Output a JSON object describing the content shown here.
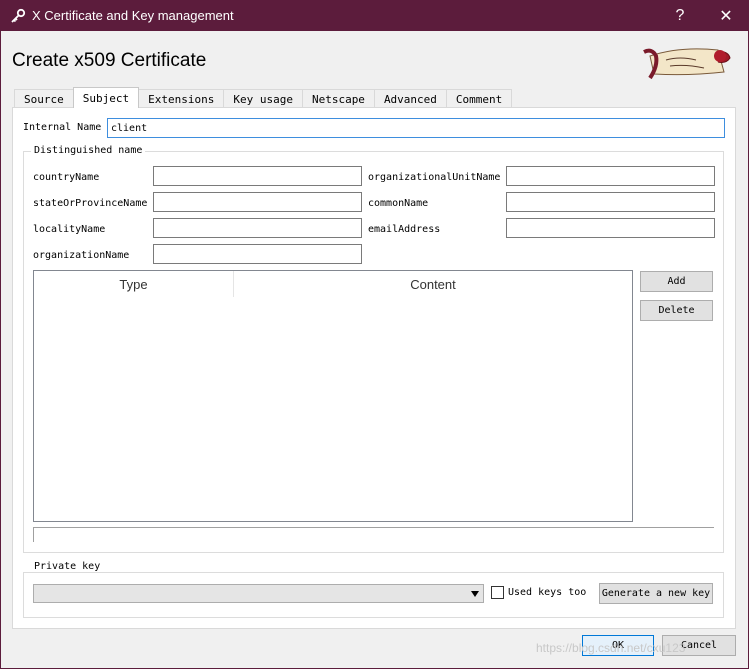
{
  "window": {
    "title": "X Certificate and Key management",
    "help_label": "?",
    "close_label": "✕"
  },
  "heading": "Create x509 Certificate",
  "tabs": [
    {
      "label": "Source",
      "active": false
    },
    {
      "label": "Subject",
      "active": true
    },
    {
      "label": "Extensions",
      "active": false
    },
    {
      "label": "Key usage",
      "active": false
    },
    {
      "label": "Netscape",
      "active": false
    },
    {
      "label": "Advanced",
      "active": false
    },
    {
      "label": "Comment",
      "active": false
    }
  ],
  "internal_name": {
    "label": "Internal Name",
    "value": "client"
  },
  "distinguished_name": {
    "title": "Distinguished name",
    "fields": {
      "countryName": {
        "label": "countryName",
        "value": ""
      },
      "stateOrProvinceName": {
        "label": "stateOrProvinceName",
        "value": ""
      },
      "localityName": {
        "label": "localityName",
        "value": ""
      },
      "organizationName": {
        "label": "organizationName",
        "value": ""
      },
      "organizationalUnitName": {
        "label": "organizationalUnitName",
        "value": ""
      },
      "commonName": {
        "label": "commonName",
        "value": ""
      },
      "emailAddress": {
        "label": "emailAddress",
        "value": ""
      }
    },
    "table": {
      "columns": [
        "Type",
        "Content"
      ],
      "rows": []
    },
    "add_label": "Add",
    "delete_label": "Delete"
  },
  "private_key": {
    "title": "Private key",
    "selected": "",
    "used_keys_label": "Used keys too",
    "used_keys_checked": false,
    "generate_label": "Generate a new key"
  },
  "footer": {
    "ok_label": "OK",
    "cancel_label": "Cancel"
  },
  "watermark": "https://blog.csdn.net/cxu123",
  "colors": {
    "titlebar": "#5c1c3c",
    "focus": "#3e8ede"
  }
}
